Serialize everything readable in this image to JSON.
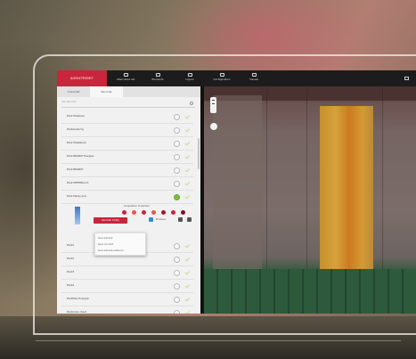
{
  "app": {
    "brand": "AGRIXTREMIT"
  },
  "nav": [
    {
      "label": "Alternative list",
      "icon": "home-icon"
    },
    {
      "label": "Elements",
      "icon": "layers-icon"
    },
    {
      "label": "Layers",
      "icon": "folder-icon"
    },
    {
      "label": "Configuration",
      "icon": "gear-icon"
    },
    {
      "label": "Visuals",
      "icon": "user-icon"
    }
  ],
  "panel": {
    "tabs": [
      "Checklist",
      "Records"
    ],
    "active_tab": "Records",
    "search_placeholder": "Cari Records",
    "rows_top": [
      {
        "label": "Plant Whatever",
        "checked": false
      },
      {
        "label": "Plant/Anatomy",
        "checked": false
      },
      {
        "label": "Plant Whatsback",
        "checked": false
      },
      {
        "label": "Plant BRANCH Energies",
        "checked": false
      },
      {
        "label": "Plant BRANCH",
        "checked": false
      },
      {
        "label": "Plant DEFEMRanch",
        "checked": false
      },
      {
        "label": "Plant Mainly plus",
        "checked": true
      }
    ],
    "controls": {
      "title": "Composition of element",
      "button_label": "Recorder Config",
      "checkbox_label": "Eineanes",
      "dot_colors": [
        "#c9253c",
        "#e3584a",
        "#c9253c",
        "#e3584a",
        "#9e1a2d",
        "#c9253c",
        "#7a1222"
      ]
    },
    "rows_bottom": [
      {
        "label": "Plant1"
      },
      {
        "label": "Plant2"
      },
      {
        "label": "Plant3"
      },
      {
        "label": "Plant4"
      },
      {
        "label": "PlantMain Energies"
      },
      {
        "label": "Plantname check"
      }
    ],
    "dropdown_items": [
      "Save element",
      "Save recorded",
      "Save element preferred"
    ]
  }
}
